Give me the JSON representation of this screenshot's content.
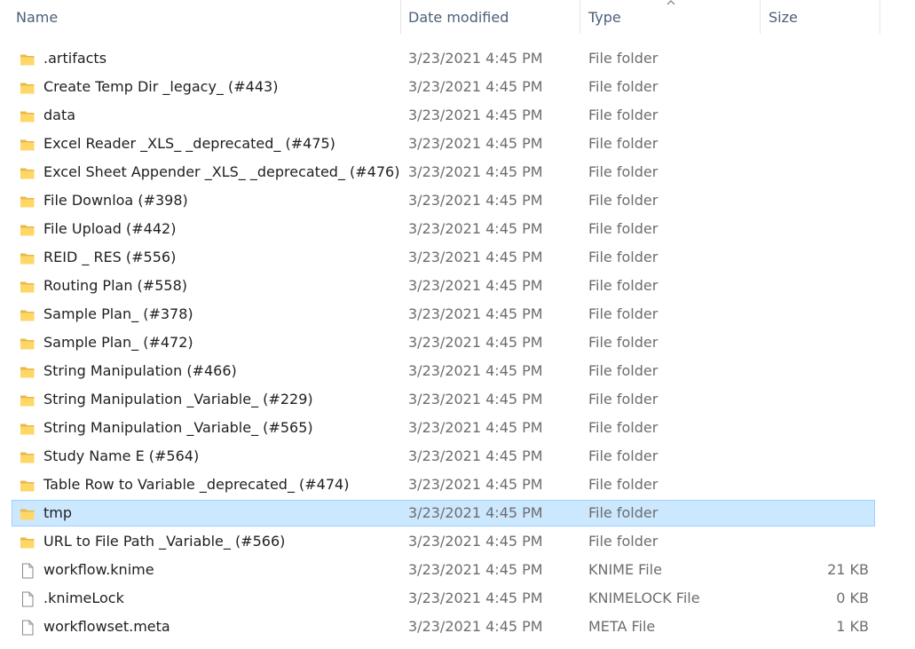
{
  "columns": {
    "name": "Name",
    "date": "Date modified",
    "type": "Type",
    "size": "Size"
  },
  "sort_icon": "chevron-up-icon",
  "selected_color": "#cce8ff",
  "folder_color": "#ffd766",
  "rows": [
    {
      "name": ".artifacts",
      "date": "3/23/2021 4:45 PM",
      "type": "File folder",
      "size": "",
      "kind": "folder"
    },
    {
      "name": "Create Temp Dir _legacy_ (#443)",
      "date": "3/23/2021 4:45 PM",
      "type": "File folder",
      "size": "",
      "kind": "folder"
    },
    {
      "name": "data",
      "date": "3/23/2021 4:45 PM",
      "type": "File folder",
      "size": "",
      "kind": "folder"
    },
    {
      "name": "Excel Reader _XLS_ _deprecated_ (#475)",
      "date": "3/23/2021 4:45 PM",
      "type": "File folder",
      "size": "",
      "kind": "folder"
    },
    {
      "name": "Excel Sheet Appender _XLS_ _deprecated_ (#476)",
      "date": "3/23/2021 4:45 PM",
      "type": "File folder",
      "size": "",
      "kind": "folder"
    },
    {
      "name": "File Downloa (#398)",
      "date": "3/23/2021 4:45 PM",
      "type": "File folder",
      "size": "",
      "kind": "folder"
    },
    {
      "name": "File Upload (#442)",
      "date": "3/23/2021 4:45 PM",
      "type": "File folder",
      "size": "",
      "kind": "folder"
    },
    {
      "name": "REID _ RES (#556)",
      "date": "3/23/2021 4:45 PM",
      "type": "File folder",
      "size": "",
      "kind": "folder"
    },
    {
      "name": "Routing Plan (#558)",
      "date": "3/23/2021 4:45 PM",
      "type": "File folder",
      "size": "",
      "kind": "folder"
    },
    {
      "name": "Sample Plan_ (#378)",
      "date": "3/23/2021 4:45 PM",
      "type": "File folder",
      "size": "",
      "kind": "folder"
    },
    {
      "name": "Sample Plan_ (#472)",
      "date": "3/23/2021 4:45 PM",
      "type": "File folder",
      "size": "",
      "kind": "folder"
    },
    {
      "name": "String Manipulation (#466)",
      "date": "3/23/2021 4:45 PM",
      "type": "File folder",
      "size": "",
      "kind": "folder"
    },
    {
      "name": "String Manipulation _Variable_ (#229)",
      "date": "3/23/2021 4:45 PM",
      "type": "File folder",
      "size": "",
      "kind": "folder"
    },
    {
      "name": "String Manipulation _Variable_ (#565)",
      "date": "3/23/2021 4:45 PM",
      "type": "File folder",
      "size": "",
      "kind": "folder"
    },
    {
      "name": "Study Name E (#564)",
      "date": "3/23/2021 4:45 PM",
      "type": "File folder",
      "size": "",
      "kind": "folder"
    },
    {
      "name": "Table Row to Variable _deprecated_ (#474)",
      "date": "3/23/2021 4:45 PM",
      "type": "File folder",
      "size": "",
      "kind": "folder"
    },
    {
      "name": "tmp",
      "date": "3/23/2021 4:45 PM",
      "type": "File folder",
      "size": "",
      "kind": "folder",
      "selected": true
    },
    {
      "name": "URL to File Path _Variable_ (#566)",
      "date": "3/23/2021 4:45 PM",
      "type": "File folder",
      "size": "",
      "kind": "folder"
    },
    {
      "name": "workflow.knime",
      "date": "3/23/2021 4:45 PM",
      "type": "KNIME File",
      "size": "21 KB",
      "kind": "file"
    },
    {
      "name": ".knimeLock",
      "date": "3/23/2021 4:45 PM",
      "type": "KNIMELOCK File",
      "size": "0 KB",
      "kind": "file"
    },
    {
      "name": "workflowset.meta",
      "date": "3/23/2021 4:45 PM",
      "type": "META File",
      "size": "1 KB",
      "kind": "file"
    }
  ]
}
